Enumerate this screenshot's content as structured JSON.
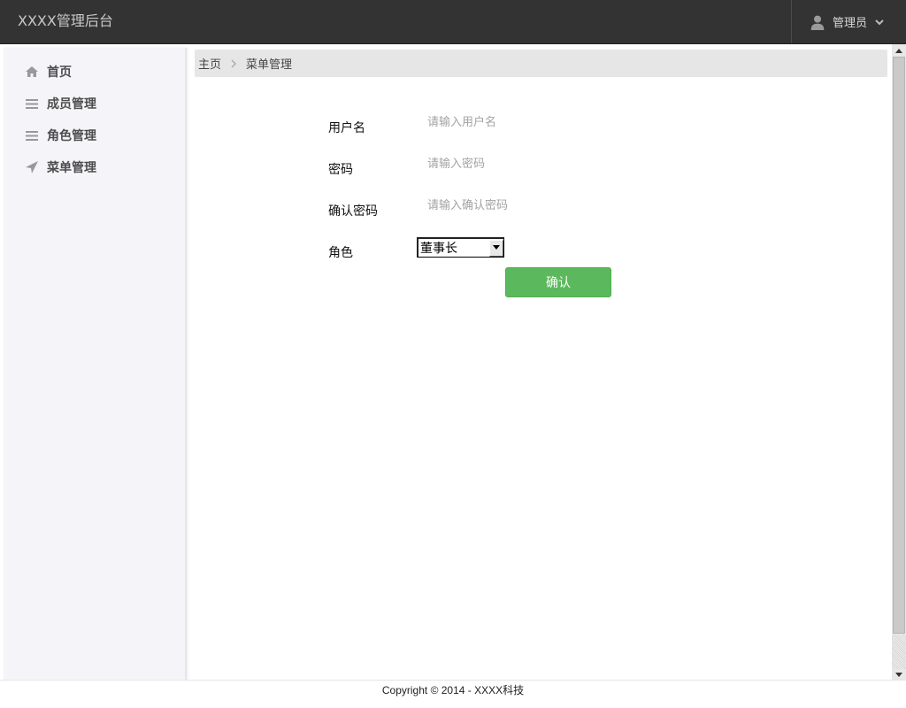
{
  "app": {
    "title": "XXXX管理后台"
  },
  "user_menu": {
    "label": "管理员",
    "icon": "user-icon"
  },
  "sidebar": {
    "items": [
      {
        "label": "首页",
        "icon": "home-icon"
      },
      {
        "label": "成员管理",
        "icon": "list-icon"
      },
      {
        "label": "角色管理",
        "icon": "list-icon"
      },
      {
        "label": "菜单管理",
        "icon": "paper-plane-icon"
      }
    ]
  },
  "breadcrumb": {
    "items": [
      "主页",
      "菜单管理"
    ]
  },
  "form": {
    "username": {
      "label": "用户名",
      "placeholder": "请输入用户名",
      "value": ""
    },
    "password": {
      "label": "密码",
      "placeholder": "请输入密码",
      "value": ""
    },
    "confirm_password": {
      "label": "确认密码",
      "placeholder": "请输入确认密码",
      "value": ""
    },
    "role": {
      "label": "角色",
      "selected": "董事长"
    },
    "submit_label": "确认"
  },
  "footer": {
    "text": "Copyright © 2014 - XXXX科技"
  },
  "colors": {
    "topbar": "#333333",
    "sidebar": "#f5f4f9",
    "breadcrumb": "#e6e6e6",
    "confirm_button": "#5cb85c"
  }
}
